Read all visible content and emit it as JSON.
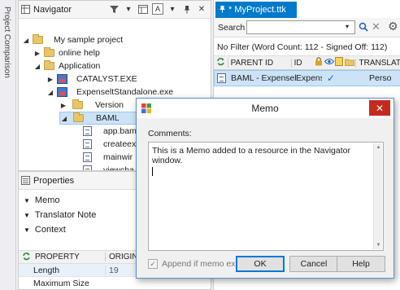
{
  "side_tab": {
    "label": "Project Comparison"
  },
  "navigator": {
    "title": "Navigator",
    "tools": {
      "view_label": "A",
      "pin": "✕"
    },
    "tree": [
      {
        "label": "My sample project",
        "type": "folder",
        "level": 0,
        "expanded": true
      },
      {
        "label": "online help",
        "type": "folder",
        "level": 1,
        "expanded": false
      },
      {
        "label": "Application",
        "type": "folder",
        "level": 1,
        "expanded": true
      },
      {
        "label": "CATALYST.EXE",
        "type": "exe",
        "level": 2,
        "expanded": false
      },
      {
        "label": "ExpenseltStandalone.exe",
        "type": "exe",
        "level": 2,
        "expanded": true
      },
      {
        "label": "Version",
        "type": "folder",
        "level": 3,
        "expanded": false
      },
      {
        "label": "BAML",
        "type": "folder",
        "level": 3,
        "expanded": true,
        "selected": true
      },
      {
        "label": "app.bam",
        "type": "file",
        "level": 4
      },
      {
        "label": "createex",
        "type": "file",
        "level": 4
      },
      {
        "label": "mainwir",
        "type": "file",
        "level": 4
      },
      {
        "label": "viewcha",
        "type": "file",
        "level": 4
      }
    ]
  },
  "properties": {
    "title": "Properties",
    "sections": [
      "Memo",
      "Translator Note",
      "Context"
    ],
    "columns": [
      "PROPERTY",
      "ORIGINA"
    ],
    "rows": [
      {
        "name": "Length",
        "value": "19"
      },
      {
        "name": "Maximum Size",
        "value": ""
      }
    ]
  },
  "editor": {
    "tab_title": "* MyProject.ttk",
    "search_label": "Search",
    "search_value": "",
    "filter_status": "No Filter (Word Count: 112 - Signed Off: 112)",
    "columns": [
      "PARENT ID",
      "ID",
      "TRANSLAT"
    ],
    "row": {
      "parent_id": "BAML - ExpenseltS",
      "id": "Expens",
      "translation": "Perso"
    }
  },
  "memo_dialog": {
    "title": "Memo",
    "comments_label": "Comments:",
    "text": "This is a Memo added to a resource in the Navigator window.",
    "append_label": "Append if memo exists",
    "append_checked": true,
    "ok_label": "OK",
    "cancel_label": "Cancel",
    "help_label": "Help"
  },
  "colors": {
    "accent": "#007acc",
    "selection": "#cce3f7",
    "close_button": "#c42b1c"
  }
}
